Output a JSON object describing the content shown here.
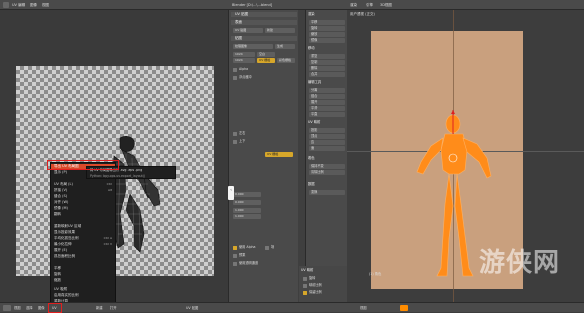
{
  "topbar": {
    "left_items": [
      "UV 编辑",
      "图像",
      "视图"
    ],
    "mid_title": "Blender  [D:\\...\\...blend]",
    "right_items": [
      "渲染",
      "引擎",
      "3D视图"
    ]
  },
  "uv_editor": {
    "context_menu": {
      "items": [
        {
          "label": "导出 UV 布局图",
          "key": ""
        },
        {
          "label": "显示 (P)",
          "key": ""
        },
        {
          "label": "",
          "key": ""
        },
        {
          "label": "UV 布局 (L)",
          "key": "Ctrl"
        },
        {
          "label": "拼接 (V)",
          "key": "Alt"
        },
        {
          "label": "缝合 (S)",
          "key": ""
        },
        {
          "label": "对齐 (W)",
          "key": ""
        },
        {
          "label": "镜像 (M)",
          "key": ""
        },
        {
          "label": "翻转",
          "key": ""
        },
        {
          "label": "",
          "key": ""
        },
        {
          "label": "重新映射UV 区域",
          "key": ""
        },
        {
          "label": "显示投影效果",
          "key": ""
        },
        {
          "label": "平均化孤岛比例",
          "key": "Ctrl A"
        },
        {
          "label": "最小化拉伸",
          "key": "Ctrl V"
        },
        {
          "label": "展开 (E)",
          "key": ""
        },
        {
          "label": "孤岛面积比例",
          "key": ""
        },
        {
          "label": "",
          "key": ""
        },
        {
          "label": "平移",
          "key": ""
        },
        {
          "label": "旋转",
          "key": ""
        },
        {
          "label": "缩放",
          "key": ""
        },
        {
          "label": "",
          "key": ""
        },
        {
          "label": "UV 吸附",
          "key": ""
        },
        {
          "label": "",
          "key": ""
        },
        {
          "label": "启用真实的比例",
          "key": ""
        },
        {
          "label": "重新计算",
          "key": ""
        }
      ],
      "highlight_index": 0
    },
    "submenu": {
      "items": [
        "将 UV 布局图导出为 .svg .eps .png",
        "Python: bpy.ops.uv.export_layout()"
      ]
    }
  },
  "bottombar": {
    "items": [
      "视图",
      "选择",
      "图像",
      "UV",
      "新建",
      "打开",
      "UV 贴图",
      "视图"
    ]
  },
  "properties": {
    "header": "UV 贴图",
    "sections": [
      {
        "label": "表面",
        "y": 14
      },
      {
        "label": "贴图",
        "y": 24
      }
    ],
    "fields": {
      "name": "UV 贴图",
      "new": "新建",
      "image": "纹理图像",
      "source": "生成",
      "size_w": "1024",
      "size_h": "1024",
      "uv_btn": "UV 栅格",
      "blank": "空白",
      "color_grid": "彩色栅格",
      "alpha": "Alpha",
      "uv_button_yellow": "UV 栅格",
      "float": "浮点缓冲",
      "lr": "左右",
      "tb": "上下",
      "x": "0.000",
      "y": "0.000",
      "w": "1.000",
      "h": "1.000",
      "use_alpha": "使用 Alpha",
      "fields_opt": "场",
      "premul": "预乘",
      "compute_alpha": "使用透明通道"
    }
  },
  "tools": {
    "heads": [
      "渲染",
      "移动",
      "编辑工具",
      "UV 映射",
      "着色",
      "数据"
    ],
    "items": [
      "平移",
      "旋转",
      "缩放",
      "镜像",
      "重复",
      "复制",
      "删除",
      "合并",
      "分离",
      "缝合",
      "展开",
      "平滑",
      "平直",
      "投影",
      "顶点",
      "边",
      "面",
      "保持不变",
      "清除比例",
      "变换"
    ]
  },
  "view3d": {
    "title": "用户透视 (正交)",
    "label": "(1) 角色",
    "watermark": "游侠网"
  },
  "op_panel": {
    "title": "UV 映射",
    "items": [
      "旋转",
      "映射比例",
      "保留比例"
    ]
  },
  "colors": {
    "accent_orange": "#ff8c00",
    "menu_highlight": "#d94a2a",
    "red_box": "#e02020",
    "yellow_button": "#d7a72a",
    "reference_plane": "#c9a07e"
  }
}
